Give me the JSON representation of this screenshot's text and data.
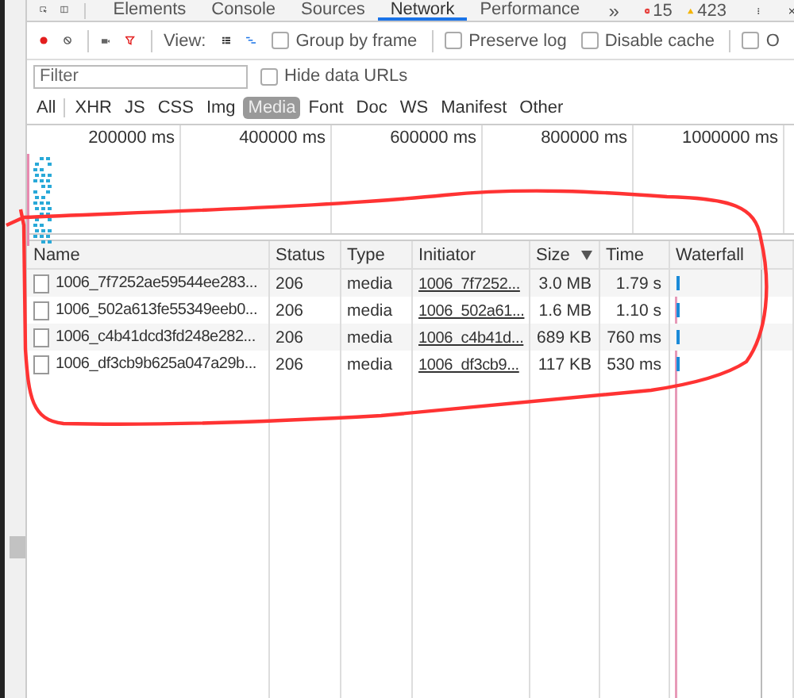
{
  "devtools_tabs": [
    {
      "label": "Elements",
      "selected": false
    },
    {
      "label": "Console",
      "selected": false
    },
    {
      "label": "Sources",
      "selected": false
    },
    {
      "label": "Network",
      "selected": true
    },
    {
      "label": "Performance",
      "selected": false
    }
  ],
  "more_tabs": "»",
  "errors": "15",
  "warnings": "423",
  "toolbar": {
    "view_label": "View:",
    "options": [
      {
        "label": "Group by frame",
        "checked": false
      },
      {
        "label": "Preserve log",
        "checked": false
      },
      {
        "label": "Disable cache",
        "checked": false
      },
      {
        "label": "O",
        "checked": false
      }
    ]
  },
  "filter": {
    "placeholder": "Filter"
  },
  "hide_data_urls": {
    "label": "Hide data URLs",
    "checked": false
  },
  "type_filters": [
    {
      "label": "All",
      "selected": false
    },
    {
      "label": "XHR",
      "selected": false
    },
    {
      "label": "JS",
      "selected": false
    },
    {
      "label": "CSS",
      "selected": false
    },
    {
      "label": "Img",
      "selected": false
    },
    {
      "label": "Media",
      "selected": true
    },
    {
      "label": "Font",
      "selected": false
    },
    {
      "label": "Doc",
      "selected": false
    },
    {
      "label": "WS",
      "selected": false
    },
    {
      "label": "Manifest",
      "selected": false
    },
    {
      "label": "Other",
      "selected": false
    }
  ],
  "timeline_ticks": [
    "200000 ms",
    "400000 ms",
    "600000 ms",
    "800000 ms",
    "1000000 ms"
  ],
  "table": {
    "columns": [
      {
        "label": "Name",
        "sorted": false
      },
      {
        "label": "Status",
        "sorted": false
      },
      {
        "label": "Type",
        "sorted": false
      },
      {
        "label": "Initiator",
        "sorted": false
      },
      {
        "label": "Size",
        "sorted": true
      },
      {
        "label": "Time",
        "sorted": false
      },
      {
        "label": "Waterfall",
        "sorted": false
      }
    ],
    "rows": [
      {
        "name": "1006_7f7252ae59544ee283...",
        "status": "206",
        "type": "media",
        "initiator": "1006_7f7252...",
        "size": "3.0 MB",
        "time": "1.79 s"
      },
      {
        "name": "1006_502a613fe55349eeb0...",
        "status": "206",
        "type": "media",
        "initiator": "1006_502a61...",
        "size": "1.6 MB",
        "time": "1.10 s"
      },
      {
        "name": "1006_c4b41dcd3fd248e282...",
        "status": "206",
        "type": "media",
        "initiator": "1006_c4b41d...",
        "size": "689 KB",
        "time": "760 ms"
      },
      {
        "name": "1006_df3cb9b625a047a29b...",
        "status": "206",
        "type": "media",
        "initiator": "1006_df3cb9...",
        "size": "117 KB",
        "time": "530 ms"
      }
    ]
  }
}
